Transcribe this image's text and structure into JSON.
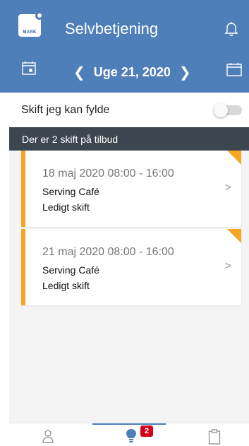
{
  "header": {
    "app_title": "Selvbetjening",
    "logo_text": "MARK",
    "bell_icon": "bell-icon",
    "colors": {
      "header_bg": "#4f7fb8"
    }
  },
  "week_nav": {
    "prev_icon": "chevron-left-icon",
    "label": "Uge 21, 2020",
    "next_icon": "chevron-right-icon",
    "left_calendar_icon": "calendar-today-icon",
    "right_calendar_icon": "calendar-icon"
  },
  "filter": {
    "label": "Skift jeg kan fylde",
    "toggle_on": false
  },
  "banner": {
    "text": "Der er 2 skift på tilbud",
    "bg_color": "#3c4650"
  },
  "shifts": [
    {
      "time": "18 maj 2020 08:00 - 16:00",
      "place": "Serving Café",
      "status": "Ledigt skift"
    },
    {
      "time": "21 maj 2020 08:00 - 16:00",
      "place": "Serving Café",
      "status": "Ledigt skift"
    }
  ],
  "accent_color": "#f5a623",
  "bottom_nav": {
    "profile_icon": "profile-icon",
    "bulb_icon": "lightbulb-icon",
    "badge_count": "2",
    "clipboard_icon": "clipboard-icon",
    "badge_color": "#d0021b"
  }
}
